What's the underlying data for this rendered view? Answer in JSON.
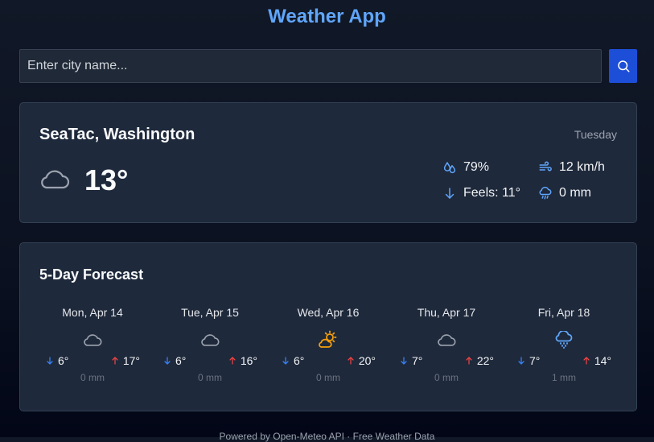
{
  "app": {
    "title": "Weather App"
  },
  "search": {
    "placeholder": "Enter city name...",
    "value": "",
    "button_icon": "search-icon"
  },
  "current": {
    "location": "SeaTac, Washington",
    "day": "Tuesday",
    "icon": "cloud-icon",
    "temperature": "13°",
    "humidity": "79%",
    "feels_like": "Feels: 11°",
    "wind": "12 km/h",
    "precipitation": "0 mm"
  },
  "forecast": {
    "title": "5-Day Forecast",
    "days": [
      {
        "date": "Mon, Apr 14",
        "icon": "cloud-icon",
        "low": "6°",
        "high": "17°",
        "precip": "0 mm"
      },
      {
        "date": "Tue, Apr 15",
        "icon": "cloud-icon",
        "low": "6°",
        "high": "16°",
        "precip": "0 mm"
      },
      {
        "date": "Wed, Apr 16",
        "icon": "partly-sunny-icon",
        "low": "6°",
        "high": "20°",
        "precip": "0 mm"
      },
      {
        "date": "Thu, Apr 17",
        "icon": "cloud-icon",
        "low": "7°",
        "high": "22°",
        "precip": "0 mm"
      },
      {
        "date": "Fri, Apr 18",
        "icon": "rain-cloud-icon",
        "low": "7°",
        "high": "14°",
        "precip": "1 mm"
      }
    ]
  },
  "footer": {
    "text": "Powered by Open-Meteo API · Free Weather Data"
  },
  "colors": {
    "accent": "#60a5fa",
    "button": "#1d4ed8",
    "card": "#1e293b",
    "low_arrow": "#3b82f6",
    "high_arrow": "#ef4444",
    "sun": "#f59e0b"
  }
}
